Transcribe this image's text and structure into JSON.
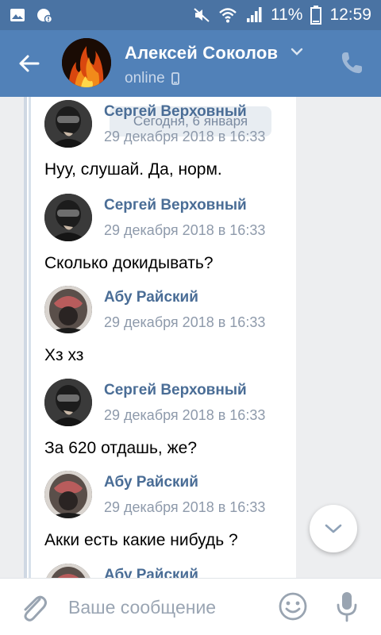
{
  "status_bar": {
    "battery": "11%",
    "time": "12:59",
    "icons": [
      "image-icon",
      "whatsapp-icon",
      "mute-icon",
      "wifi-icon",
      "signal-icon",
      "battery-icon"
    ]
  },
  "header": {
    "name": "Алексей Соколов",
    "status": "online",
    "icons": [
      "back-arrow-icon",
      "chevron-down-icon",
      "phone-icon",
      "mobile-icon"
    ]
  },
  "date_chip": "Сегодня, 6 января",
  "messages": [
    {
      "author": "Сергей Верховный",
      "time": "29 декабря 2018 в 16:33",
      "text": "Нуу, слушай. Да, норм."
    },
    {
      "author": "Сергей Верховный",
      "time": "29 декабря 2018 в 16:33",
      "text": "Сколько докидывать?"
    },
    {
      "author": "Абу Райский",
      "time": "29 декабря 2018 в 16:33",
      "text": "Хз хз"
    },
    {
      "author": "Сергей Верховный",
      "time": "29 декабря 2018 в 16:33",
      "text": "За 620 отдашь, же?"
    },
    {
      "author": "Абу Райский",
      "time": "29 декабря 2018 в 16:33",
      "text": "Акки есть какие нибудь ?"
    },
    {
      "author": "Абу Райский",
      "time": "",
      "text": ""
    }
  ],
  "composer": {
    "placeholder": "Ваше сообщение",
    "icons": [
      "attach-icon",
      "smile-icon",
      "mic-icon"
    ]
  },
  "colors": {
    "header_bg": "#5181b8",
    "status_bar_bg": "#4a73a3",
    "author_color": "#4a6d96",
    "time_color": "#8e9aab"
  }
}
